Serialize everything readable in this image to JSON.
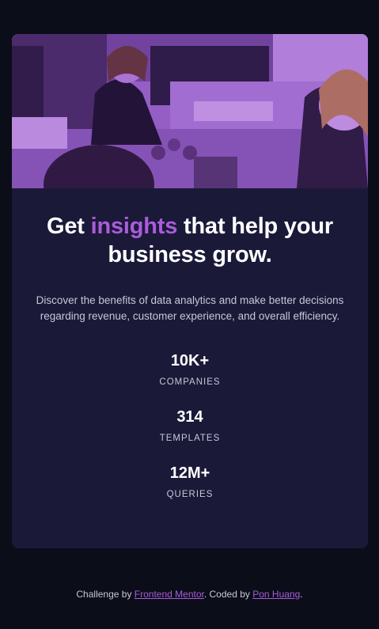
{
  "card": {
    "image_alt": "Photo of colleagues working at a table",
    "headline_before": "Get ",
    "headline_accent": "insights",
    "headline_after": " that help your business grow.",
    "description": "Discover the benefits of data analytics and make better decisions regarding revenue, customer experience, and overall efficiency.",
    "stats": [
      {
        "value": "10K+",
        "label": "COMPANIES"
      },
      {
        "value": "314",
        "label": "TEMPLATES"
      },
      {
        "value": "12M+",
        "label": "QUERIES"
      }
    ]
  },
  "footer": {
    "prefix": "Challenge by ",
    "challenge_link": "Frontend Mentor",
    "middle": ". Coded by ",
    "author_link": "Pon Huang",
    "suffix": "."
  },
  "colors": {
    "page_bg": "#0b0d19",
    "card_bg": "#1b1938",
    "accent": "#aa5cdb",
    "text_muted": "#c9c6d8"
  }
}
